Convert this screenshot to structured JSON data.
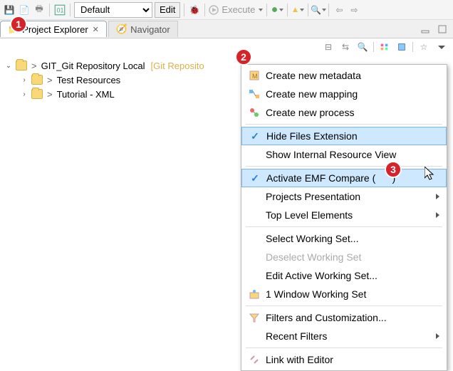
{
  "toolbar": {
    "context_combo": "Default",
    "edit_label": "Edit",
    "execute_label": "Execute"
  },
  "tabs": {
    "project_explorer": "Project Explorer",
    "navigator": "Navigator"
  },
  "tree": {
    "root_prefix": ">",
    "root_name": "GIT_Git Repository Local",
    "root_suffix": "[Git Reposito",
    "child1_prefix": ">",
    "child1_name": "Test Resources",
    "child2_prefix": ">",
    "child2_name": "Tutorial - XML"
  },
  "menu": {
    "create_metadata": "Create new metadata",
    "create_mapping": "Create new mapping",
    "create_process": "Create new process",
    "hide_ext": "Hide Files Extension",
    "internal_view": "Show Internal Resource View",
    "activate_emf": "Activate EMF Compare (",
    "activate_emf_tail": ")",
    "projects_presentation": "Projects Presentation",
    "top_level": "Top Level Elements",
    "select_ws": "Select Working Set...",
    "deselect_ws": "Deselect Working Set",
    "edit_ws": "Edit Active Working Set...",
    "window_ws": "1 Window Working Set",
    "filters": "Filters and Customization...",
    "recent_filters": "Recent Filters",
    "link_editor": "Link with Editor"
  },
  "annotations": {
    "a1": "1",
    "a2": "2",
    "a3": "3"
  }
}
